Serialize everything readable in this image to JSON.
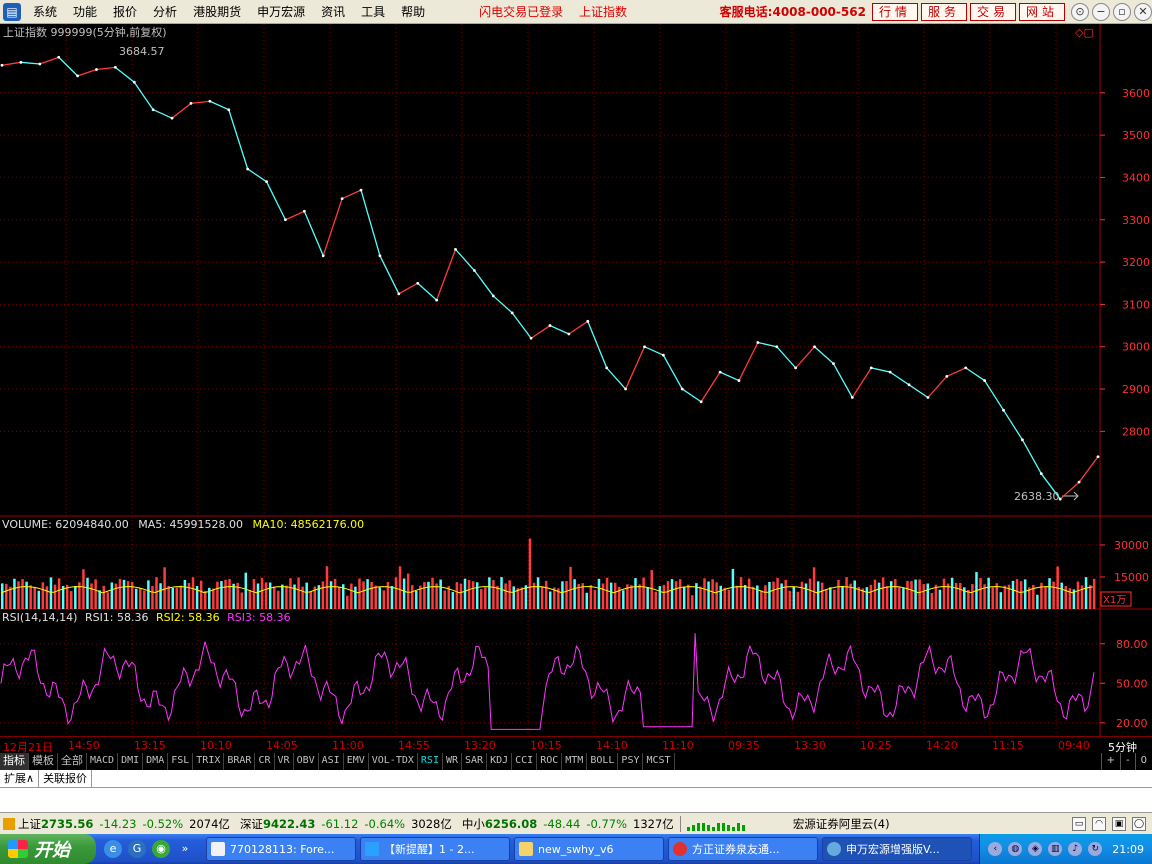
{
  "menubar": {
    "items": [
      "系统",
      "功能",
      "报价",
      "分析",
      "港股期货",
      "申万宏源",
      "资讯",
      "工具",
      "帮助"
    ],
    "status_login": "闪电交易已登录",
    "status_index": "上证指数",
    "hotline": "客服电话:4008-000-562",
    "buttons": [
      "行情",
      "服务",
      "交易",
      "网站"
    ]
  },
  "chart": {
    "title": "上证指数 999999(5分钟,前复权)",
    "high_label": "3684.57",
    "low_label": "2638.30",
    "price_ticks": [
      "3600",
      "3500",
      "3400",
      "3300",
      "3200",
      "3100",
      "3000",
      "2900",
      "2800"
    ],
    "volume_header": {
      "label": "VOLUME: 62094840.00",
      "ma5": "MA5: 45991528.00",
      "ma10": "MA10: 48562176.00"
    },
    "volume_ticks": [
      "30000",
      "15000"
    ],
    "volume_unit": "X1万",
    "rsi_header": {
      "label": "RSI(14,14,14)",
      "rsi1": "RSI1: 58.36",
      "rsi2": "RSI2: 58.36",
      "rsi3": "RSI3: 58.36"
    },
    "rsi_ticks": [
      "80.00",
      "50.00",
      "20.00"
    ],
    "colors": {
      "up": "#ff3b3b",
      "down": "#54ffff",
      "grid": "#7a0000",
      "ma10": "#ffff00",
      "rsi": "#ff33ff"
    }
  },
  "chart_data": {
    "type": "line",
    "title": "上证指数 999999(5分钟,前复权)",
    "ylim": [
      2600,
      3720
    ],
    "x": [
      "12月21日",
      "14:50",
      "13:15",
      "10:10",
      "14:05",
      "11:00",
      "14:55",
      "13:20",
      "10:15",
      "14:10",
      "11:10",
      "09:35",
      "13:30",
      "10:25",
      "14:20",
      "11:15",
      "09:40"
    ],
    "price_series": {
      "values": [
        3665,
        3672,
        3668,
        3684,
        3640,
        3655,
        3660,
        3625,
        3560,
        3540,
        3575,
        3580,
        3560,
        3420,
        3390,
        3300,
        3320,
        3215,
        3350,
        3370,
        3215,
        3125,
        3150,
        3110,
        3230,
        3180,
        3120,
        3080,
        3020,
        3050,
        3030,
        3060,
        2950,
        2900,
        3000,
        2980,
        2900,
        2870,
        2940,
        2920,
        3010,
        3000,
        2950,
        3000,
        2960,
        2880,
        2950,
        2940,
        2910,
        2880,
        2930,
        2950,
        2920,
        2850,
        2780,
        2700,
        2640,
        2680,
        2740
      ]
    },
    "high": 3684.57,
    "low": 2638.3,
    "volume": {
      "ylim": [
        0,
        37000
      ],
      "ticks": [
        15000,
        30000
      ],
      "unit": "X1万"
    },
    "rsi": {
      "ylim": [
        10,
        95
      ],
      "ticks": [
        20,
        50,
        80
      ],
      "last": 58.36
    }
  },
  "timebar": {
    "labels": [
      "12月21日",
      "14:50",
      "13:15",
      "10:10",
      "14:05",
      "11:00",
      "14:55",
      "13:20",
      "10:15",
      "14:10",
      "11:10",
      "09:35",
      "13:30",
      "10:25",
      "14:20",
      "11:15",
      "09:40"
    ],
    "period": "5分钟"
  },
  "tabs": {
    "items": [
      "指标",
      "模板",
      "全部",
      "MACD",
      "DMI",
      "DMA",
      "FSL",
      "TRIX",
      "BRAR",
      "CR",
      "VR",
      "OBV",
      "ASI",
      "EMV",
      "VOL-TDX",
      "RSI",
      "WR",
      "SAR",
      "KDJ",
      "CCI",
      "ROC",
      "MTM",
      "BOLL",
      "PSY",
      "MCST"
    ],
    "active": "RSI",
    "controls": [
      "+",
      "-",
      "0"
    ]
  },
  "expand": {
    "items": [
      "扩展∧",
      "关联报价"
    ]
  },
  "statusbar": {
    "sh_name": "上证",
    "sh_val": "2735.56",
    "sh_chg": "-14.23",
    "sh_pct": "-0.52%",
    "sh_amt": "2074亿",
    "sz_name": "深证",
    "sz_val": "9422.43",
    "sz_chg": "-61.12",
    "sz_pct": "-0.64%",
    "sz_amt": "3028亿",
    "zx_name": "中小",
    "zx_val": "6256.08",
    "zx_chg": "-48.44",
    "zx_pct": "-0.77%",
    "zx_amt": "1327亿",
    "broker": "宏源证券阿里云(4)"
  },
  "taskbar": {
    "start": "开始",
    "tasks": [
      "770128113: Fore...",
      "【新提醒】1 - 2...",
      "new_swhy_v6",
      "方正证券泉友通...",
      "申万宏源增强版V..."
    ],
    "clock": "21:09"
  }
}
